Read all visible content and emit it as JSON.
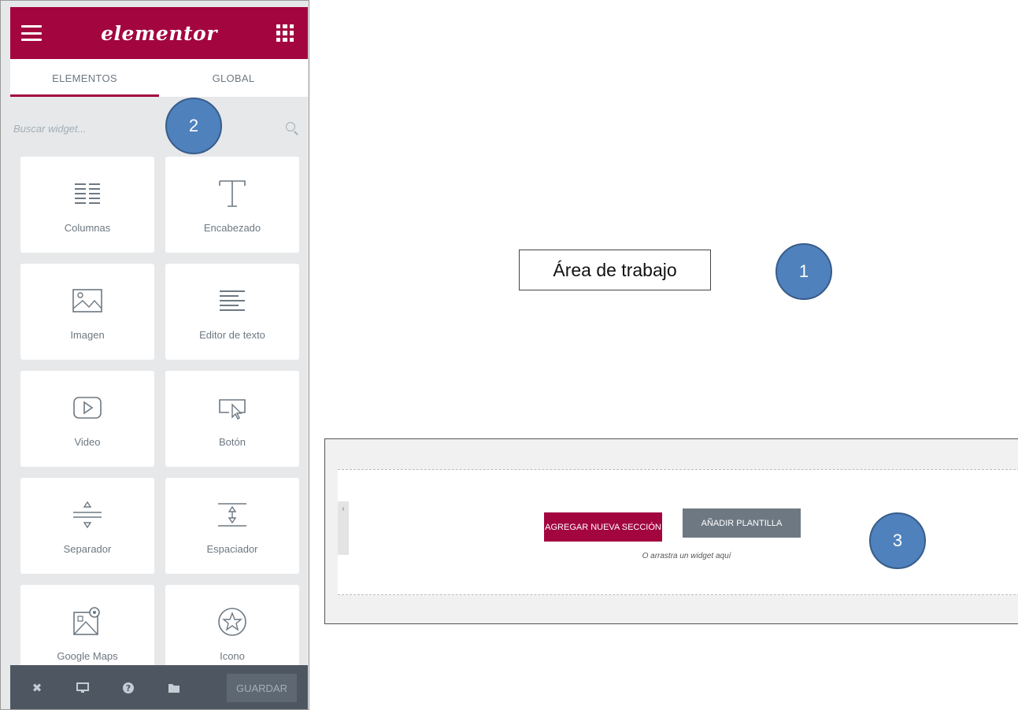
{
  "panel": {
    "brand": "elementor",
    "tabs": [
      {
        "label": "ELEMENTOS",
        "active": true
      },
      {
        "label": "GLOBAL",
        "active": false
      }
    ],
    "search": {
      "placeholder": "Buscar widget..."
    },
    "widgets": [
      {
        "label": "Columnas",
        "icon": "columns-icon"
      },
      {
        "label": "Encabezado",
        "icon": "heading-icon"
      },
      {
        "label": "Imagen",
        "icon": "image-icon"
      },
      {
        "label": "Editor de texto",
        "icon": "text-editor-icon"
      },
      {
        "label": "Video",
        "icon": "video-icon"
      },
      {
        "label": "Botón",
        "icon": "button-icon"
      },
      {
        "label": "Separador",
        "icon": "divider-icon"
      },
      {
        "label": "Espaciador",
        "icon": "spacer-icon"
      },
      {
        "label": "Google Maps",
        "icon": "map-icon"
      },
      {
        "label": "Icono",
        "icon": "star-icon"
      }
    ],
    "footer": {
      "save_label": "GUARDAR"
    }
  },
  "workspace": {
    "area_label": "Área de trabajo",
    "add_section_label": "AGREGAR NUEVA SECCIÓN",
    "add_template_label": "AÑADIR PLANTILLA",
    "drop_hint": "O arrastra un widget aquí",
    "collapse_glyph": "‹"
  },
  "badges": [
    "1",
    "2",
    "3"
  ],
  "colors": {
    "brand": "#a3063f",
    "badge": "#4f81bd",
    "footer": "#4e5761"
  }
}
